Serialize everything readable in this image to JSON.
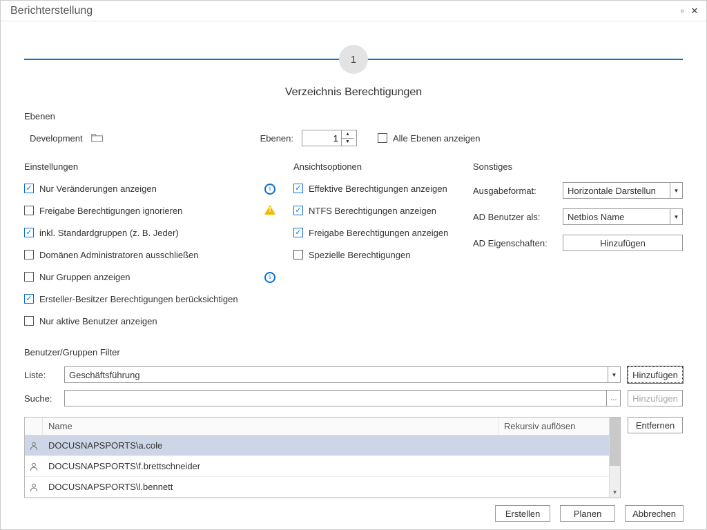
{
  "window": {
    "title": "Berichterstellung"
  },
  "step": {
    "number": "1",
    "title": "Verzeichnis Berechtigungen"
  },
  "ebenen": {
    "section": "Ebenen",
    "path": "Development",
    "levels_label": "Ebenen:",
    "levels_value": "1",
    "show_all": "Alle Ebenen anzeigen"
  },
  "einstellungen": {
    "title": "Einstellungen",
    "items": [
      {
        "label": "Nur Veränderungen anzeigen",
        "checked": true,
        "icon": "info"
      },
      {
        "label": "Freigabe Berechtigungen ignorieren",
        "checked": false,
        "icon": "warn"
      },
      {
        "label": "inkl. Standardgruppen (z. B. Jeder)",
        "checked": true,
        "icon": ""
      },
      {
        "label": "Domänen Administratoren ausschließen",
        "checked": false,
        "icon": ""
      },
      {
        "label": "Nur Gruppen anzeigen",
        "checked": false,
        "icon": "info"
      },
      {
        "label": "Ersteller-Besitzer Berechtigungen berücksichtigen",
        "checked": true,
        "icon": ""
      },
      {
        "label": "Nur aktive Benutzer anzeigen",
        "checked": false,
        "icon": ""
      }
    ]
  },
  "ansicht": {
    "title": "Ansichtsoptionen",
    "items": [
      {
        "label": "Effektive Berechtigungen anzeigen",
        "checked": true
      },
      {
        "label": "NTFS Berechtigungen anzeigen",
        "checked": true
      },
      {
        "label": "Freigabe Berechtigungen anzeigen",
        "checked": true
      },
      {
        "label": "Spezielle Berechtigungen",
        "checked": false
      }
    ]
  },
  "sonstiges": {
    "title": "Sonstiges",
    "format_label": "Ausgabeformat:",
    "format_value": "Horizontale Darstellun",
    "user_label": "AD Benutzer als:",
    "user_value": "Netbios Name",
    "props_label": "AD Eigenschaften:",
    "props_button": "Hinzufügen"
  },
  "filter": {
    "title": "Benutzer/Gruppen Filter",
    "list_label": "Liste:",
    "list_value": "Geschäftsführung",
    "list_add": "Hinzufügen",
    "search_label": "Suche:",
    "search_add": "Hinzufügen",
    "remove": "Entfernen",
    "columns": {
      "name": "Name",
      "recursive": "Rekursiv auflösen"
    },
    "rows": [
      {
        "name": "DOCUSNAPSPORTS\\a.cole",
        "selected": true
      },
      {
        "name": "DOCUSNAPSPORTS\\f.brettschneider",
        "selected": false
      },
      {
        "name": "DOCUSNAPSPORTS\\l.bennett",
        "selected": false
      }
    ]
  },
  "footer": {
    "create": "Erstellen",
    "plan": "Planen",
    "cancel": "Abbrechen"
  }
}
